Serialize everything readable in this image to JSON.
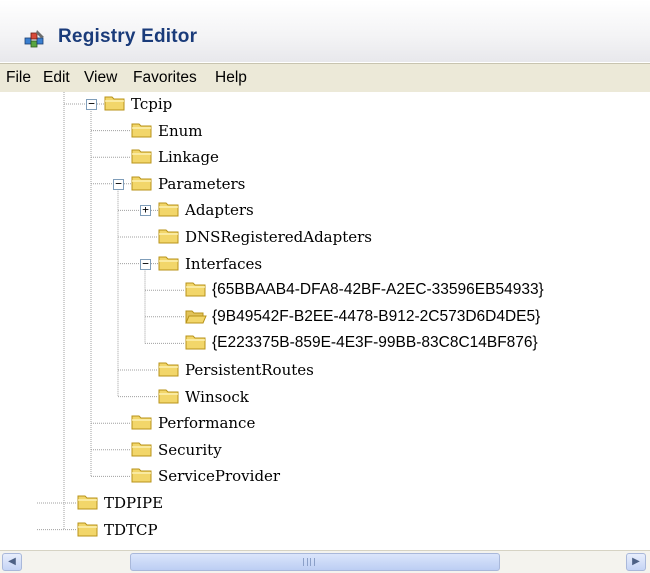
{
  "window": {
    "title": "Registry Editor",
    "icon": "registry-editor-icon"
  },
  "menu": [
    "File",
    "Edit",
    "View",
    "Favorites",
    "Help"
  ],
  "tree": [
    {
      "label": "Tcpip",
      "level": 0,
      "expander": "minus"
    },
    {
      "label": "Enum",
      "level": 1,
      "expander": null
    },
    {
      "label": "Linkage",
      "level": 1,
      "expander": null
    },
    {
      "label": "Parameters",
      "level": 1,
      "expander": "minus"
    },
    {
      "label": "Adapters",
      "level": 2,
      "expander": "plus"
    },
    {
      "label": "DNSRegisteredAdapters",
      "level": 2,
      "expander": null
    },
    {
      "label": "Interfaces",
      "level": 2,
      "expander": "minus"
    },
    {
      "label": "{65BBAAB4-DFA8-42BF-A2EC-33596EB54933}",
      "level": 3,
      "expander": null
    },
    {
      "label": "{9B49542F-B2EE-4478-B912-2C573D6D4DE5}",
      "level": 3,
      "expander": null,
      "open": true
    },
    {
      "label": "{E223375B-859E-4E3F-99BB-83C8C14BF876}",
      "level": 3,
      "expander": null
    },
    {
      "label": "PersistentRoutes",
      "level": 2,
      "expander": null
    },
    {
      "label": "Winsock",
      "level": 2,
      "expander": null
    },
    {
      "label": "Performance",
      "level": 1,
      "expander": null
    },
    {
      "label": "Security",
      "level": 1,
      "expander": null
    },
    {
      "label": "ServiceProvider",
      "level": 1,
      "expander": null
    },
    {
      "label": "TDPIPE",
      "level": -1,
      "expander": null
    },
    {
      "label": "TDTCP",
      "level": -1,
      "expander": null
    }
  ],
  "colors": {
    "folder": "#f2d66a",
    "folder_edge": "#b8931a",
    "accent": "#1a3b7a",
    "menubar": "#ece9d8"
  }
}
